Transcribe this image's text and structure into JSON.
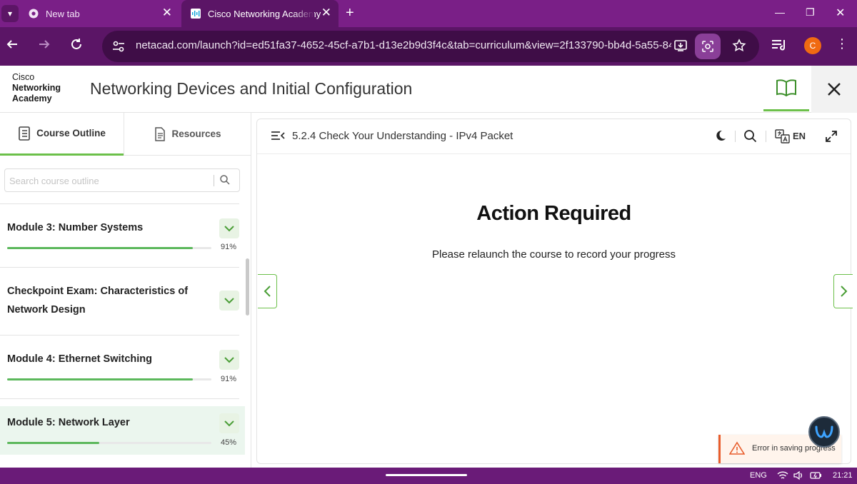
{
  "browser": {
    "tabs": [
      {
        "label": "New tab"
      },
      {
        "label": "Cisco Networking Academy"
      }
    ],
    "new_tab_symbol": "+",
    "url": "netacad.com/launch?id=ed51fa37-4652-45cf-a7b1-d13e2b9d3f4c&tab=curriculum&view=2f133790-bb4d-5a55-8412...",
    "profile_initial": "C",
    "theme_color": "#7a1f87"
  },
  "header": {
    "logo_line1": "Cisco",
    "logo_line2": "Networking",
    "logo_line3": "Academy",
    "course_title": "Networking Devices and Initial Configuration"
  },
  "sidebar": {
    "tabs": [
      {
        "label": "Course Outline",
        "icon": "outline-icon"
      },
      {
        "label": "Resources",
        "icon": "document-icon"
      }
    ],
    "search_placeholder": "Search course outline",
    "modules": [
      {
        "title": "Module 3: Number Systems",
        "progress": 0.91,
        "pct": "91%"
      },
      {
        "title": "Checkpoint Exam: Characteristics of Network Design"
      },
      {
        "title": "Module 4: Ethernet Switching",
        "progress": 0.91,
        "pct": "91%"
      },
      {
        "title": "Module 5: Network Layer",
        "progress": 0.45,
        "pct": "45%",
        "active": true
      }
    ]
  },
  "main": {
    "page_title": "5.2.4 Check Your Understanding - IPv4 Packet",
    "language": "EN",
    "heading": "Action Required",
    "message": "Please relaunch the course to record your progress"
  },
  "toast": {
    "message": "Error in saving progress",
    "accent": "#e85d2c"
  },
  "taskbar": {
    "language": "ENG",
    "time": "21:21"
  },
  "accent_color": "#6cc04a"
}
